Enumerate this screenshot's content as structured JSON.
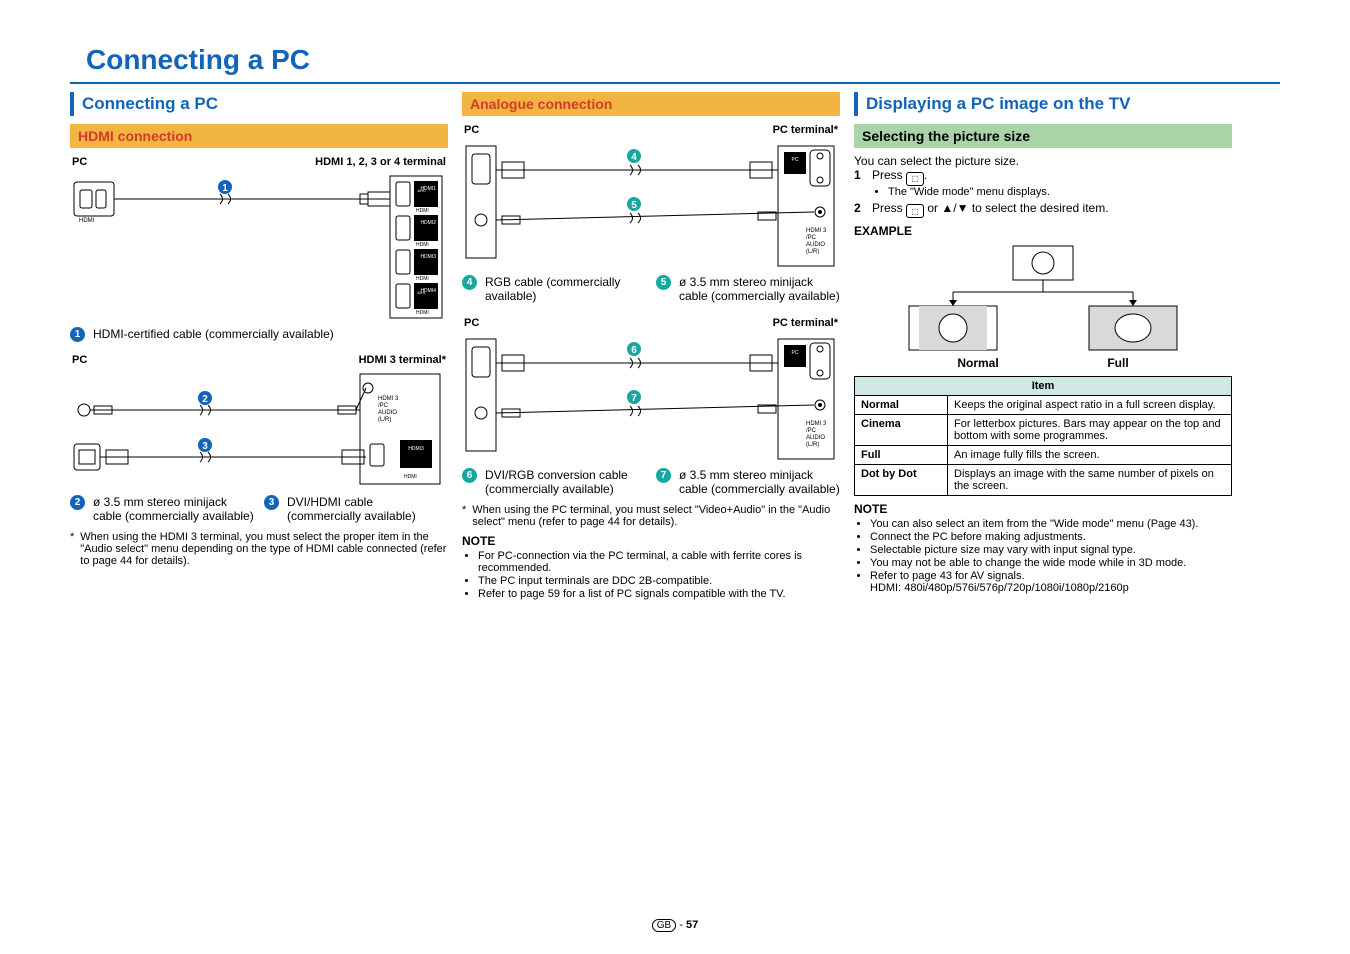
{
  "page": {
    "title": "Connecting a PC",
    "region": "GB",
    "number": "57"
  },
  "col1": {
    "heading": "Connecting a PC",
    "hdmi_band": "HDMI connection",
    "d1": {
      "left": "PC",
      "right": "HDMI 1, 2, 3 or 4 terminal"
    },
    "legend1": "HDMI-certified cable (commercially available)",
    "d2": {
      "left": "PC",
      "right": "HDMI 3 terminal*"
    },
    "legend2": "ø 3.5 mm stereo minijack cable (commercially available)",
    "legend3": "DVI/HDMI cable (commercially available)",
    "footnote": "When using the HDMI 3 terminal, you must select the proper item in the \"Audio select\" menu depending on the type of HDMI cable connected (refer to page 44 for details)."
  },
  "col2": {
    "band": "Analogue connection",
    "d1": {
      "left": "PC",
      "right": "PC terminal*"
    },
    "legend4": "RGB cable (commercially available)",
    "legend5": "ø 3.5 mm stereo minijack cable (commercially available)",
    "d2": {
      "left": "PC",
      "right": "PC terminal*"
    },
    "legend6": "DVI/RGB conversion cable (commercially available)",
    "legend7": "ø 3.5 mm stereo minijack cable (commercially available)",
    "footnote": "When using the PC terminal, you must select \"Video+Audio\" in the \"Audio select\" menu (refer to page 44 for details).",
    "note_head": "NOTE",
    "notes": [
      "For PC-connection via the PC terminal, a cable with ferrite cores is recommended.",
      "The PC input terminals are DDC 2B-compatible.",
      "Refer to page 59 for a list of PC signals compatible with the TV."
    ]
  },
  "col3": {
    "heading": "Displaying a PC image on the TV",
    "green": "Selecting the picture size",
    "intro": "You can select the picture size.",
    "step1a": "Press ",
    "step1b": ".",
    "step1_sub": "The \"Wide mode\" menu displays.",
    "step2a": "Press ",
    "step2b": " or ",
    "step2c": " to select the desired item.",
    "example_head": "EXAMPLE",
    "ex_normal": "Normal",
    "ex_full": "Full",
    "table_head": "Item",
    "rows": [
      {
        "k": "Normal",
        "v": "Keeps the original aspect ratio in a full screen display."
      },
      {
        "k": "Cinema",
        "v": "For letterbox pictures. Bars may appear on the top and bottom with some programmes."
      },
      {
        "k": "Full",
        "v": "An image fully fills the screen."
      },
      {
        "k": "Dot by Dot",
        "v": "Displays an image with the same number of pixels on the screen."
      }
    ],
    "note_head": "NOTE",
    "notes": [
      "You can also select an item from the \"Wide mode\" menu (Page 43).",
      "Connect the PC before making adjustments.",
      "Selectable picture size may vary with input signal type.",
      "You may not be able to change the wide mode while in 3D mode.",
      "Refer to page 43 for AV signals.\nHDMI: 480i/480p/576i/576p/720p/1080i/1080p/2160p"
    ]
  }
}
